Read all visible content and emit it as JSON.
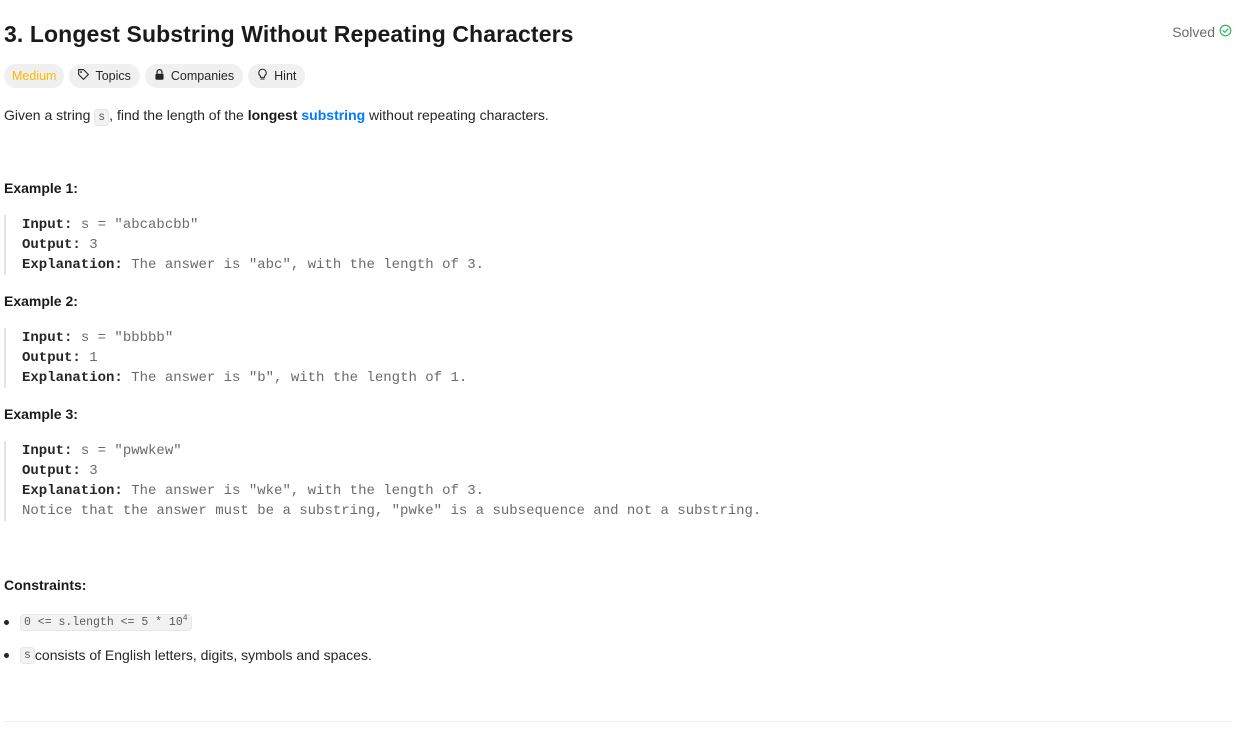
{
  "problem": {
    "title": "3. Longest Substring Without Repeating Characters",
    "status": "Solved"
  },
  "chips": {
    "difficulty": "Medium",
    "topics": "Topics",
    "companies": "Companies",
    "hint": "Hint"
  },
  "description": {
    "part1": "Given a string ",
    "code": "s",
    "part2": ", find the length of the ",
    "bold": "longest",
    "link": "substring",
    "part3": " without repeating characters."
  },
  "examples": [
    {
      "heading": "Example 1:",
      "input_label": "Input:",
      "input": " s = \"abcabcbb\"",
      "output_label": "Output:",
      "output": " 3",
      "explanation_label": "Explanation:",
      "explanation": " The answer is \"abc\", with the length of 3."
    },
    {
      "heading": "Example 2:",
      "input_label": "Input:",
      "input": " s = \"bbbbb\"",
      "output_label": "Output:",
      "output": " 1",
      "explanation_label": "Explanation:",
      "explanation": " The answer is \"b\", with the length of 1."
    },
    {
      "heading": "Example 3:",
      "input_label": "Input:",
      "input": " s = \"pwwkew\"",
      "output_label": "Output:",
      "output": " 3",
      "explanation_label": "Explanation:",
      "explanation": " The answer is \"wke\", with the length of 3.",
      "note": "Notice that the answer must be a substring, \"pwke\" is a subsequence and not a substring."
    }
  ],
  "constraints": {
    "heading": "Constraints:",
    "item1_code": "0 <= s.length <= 5 * 10",
    "item1_sup": "4",
    "item2_code": "s",
    "item2_text": " consists of English letters, digits, symbols and spaces."
  },
  "colors": {
    "medium": "#ffb800",
    "solved_check": "#2cbb5d",
    "link": "#007aff"
  },
  "icons": {
    "solved": "check-circle-icon",
    "topics": "tag-icon",
    "companies": "lock-icon",
    "hint": "lightbulb-icon"
  }
}
